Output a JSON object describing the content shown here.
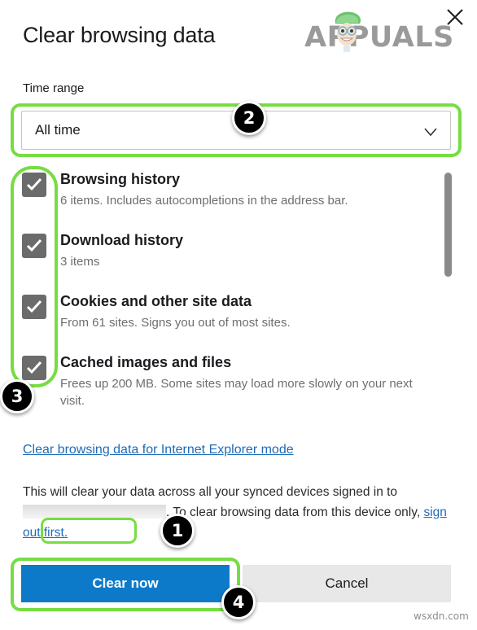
{
  "dialog": {
    "title": "Clear browsing data",
    "close_icon": "close-icon"
  },
  "brand": {
    "logo_text": "APPUALS"
  },
  "time_range": {
    "label": "Time range",
    "selected": "All time",
    "chevron_icon": "chevron-down-icon"
  },
  "items": [
    {
      "title": "Browsing history",
      "subtitle": "6 items. Includes autocompletions in the address bar.",
      "checked": true
    },
    {
      "title": "Download history",
      "subtitle": "3 items",
      "checked": true
    },
    {
      "title": "Cookies and other site data",
      "subtitle": "From 61 sites. Signs you out of most sites.",
      "checked": true
    },
    {
      "title": "Cached images and files",
      "subtitle": "Frees up 200 MB. Some sites may load more slowly on your next visit.",
      "checked": true
    }
  ],
  "ie_link": {
    "label": "Clear browsing data for Internet Explorer mode"
  },
  "sync_note": {
    "part1": "This will clear your data across all your synced devices signed in to",
    "redacted": "",
    "part2": ". To clear browsing data from this device only,",
    "link": "sign out first.",
    "trailing": ""
  },
  "buttons": {
    "primary": "Clear now",
    "secondary": "Cancel"
  },
  "badges": {
    "one": "1",
    "two": "2",
    "three": "3",
    "four": "4"
  },
  "watermark": {
    "text": "wsxdn.com"
  },
  "colors": {
    "highlight_green": "#76dd42",
    "primary_blue": "#0d7ac9",
    "link_blue": "#1f6bb8",
    "checkbox_gray": "#6b6b6b",
    "badge_black": "#000000"
  }
}
